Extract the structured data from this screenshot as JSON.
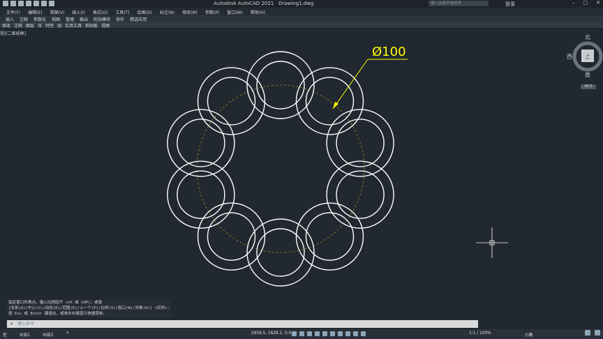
{
  "titlebar": {
    "app": "Autodesk AutoCAD 2021",
    "file": "Drawing1.dwg",
    "search_placeholder": "键入关键字或短语",
    "user": "登录"
  },
  "menus": [
    "文件(F)",
    "编辑(E)",
    "视图(V)",
    "插入(I)",
    "格式(O)",
    "工具(T)",
    "绘图(D)",
    "标注(N)",
    "修改(M)",
    "参数(P)",
    "窗口(W)",
    "帮助(H)"
  ],
  "tabs": [
    "插入",
    "注释",
    "参数化",
    "视图",
    "管理",
    "输出",
    "附加模块",
    "协作",
    "精选应用"
  ],
  "ribbon": [
    "修改",
    "注释",
    "图层",
    "块",
    "特性",
    "组",
    "实用工具",
    "剪贴板",
    "视图"
  ],
  "viewport_label": "视][二维线框]",
  "dimension": "Ø100",
  "viewcube": {
    "north": "北",
    "west": "西",
    "south": "南",
    "face": "上",
    "ucs": "WCS"
  },
  "command_history": [
    "指定窗口的角点，输入比例因子 (nX 或 nXP)，或者",
    "[全部(A)/中心(C)/动态(D)/范围(E)/上一个(P)/比例(S)/窗口(W)/对象(O)] <实时>:",
    "按 Esc 或 Enter 键退出，或单击右键显示快捷菜单。"
  ],
  "command_placeholder": "键入命令",
  "layout_tabs": [
    "型",
    "布局1",
    "布局2",
    "+"
  ],
  "status": {
    "coords": "2959.5, 1628.1, 0.0",
    "scale": "1:1 / 100%",
    "units": "小数"
  },
  "colors": {
    "background": "#212830",
    "ring": "#ffffff",
    "dimension": "#ffff00",
    "centerline": "#a08520"
  }
}
